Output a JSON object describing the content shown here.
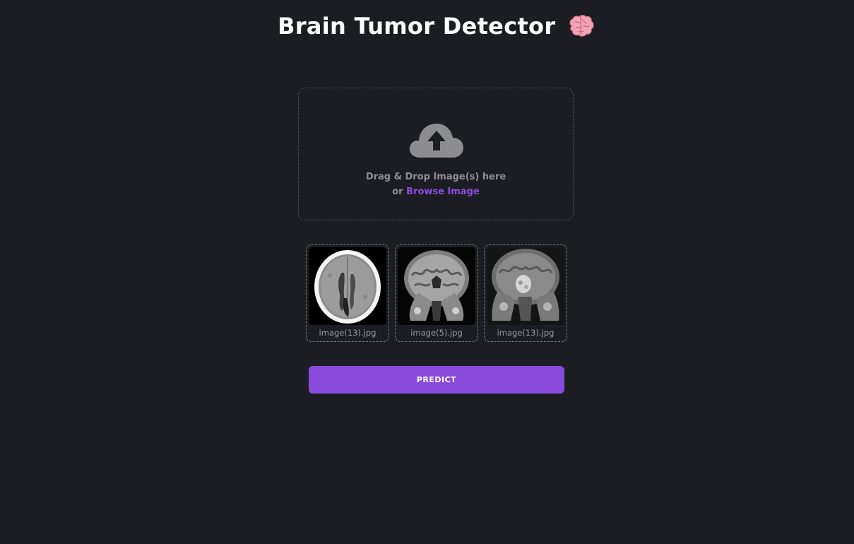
{
  "header": {
    "title": "Brain Tumor Detector",
    "emoji_icon": "brain-icon"
  },
  "upload": {
    "icon": "cloud-upload-icon",
    "line1": "Drag & Drop Image(s) here",
    "line2_prefix": "or",
    "browse_label": "Browse Image"
  },
  "thumbnails": [
    {
      "filename": "image(13).jpg",
      "kind": "axial-ct-scan"
    },
    {
      "filename": "image(5).jpg",
      "kind": "coronal-mri-scan"
    },
    {
      "filename": "image(13).jpg",
      "kind": "coronal-mri-tumor-scan"
    }
  ],
  "actions": {
    "predict_label": "PREDICT"
  },
  "colors": {
    "background": "#1c1d22",
    "accent": "#8a4bdc",
    "link": "#8b4de0",
    "muted_text": "#8e8f95"
  }
}
